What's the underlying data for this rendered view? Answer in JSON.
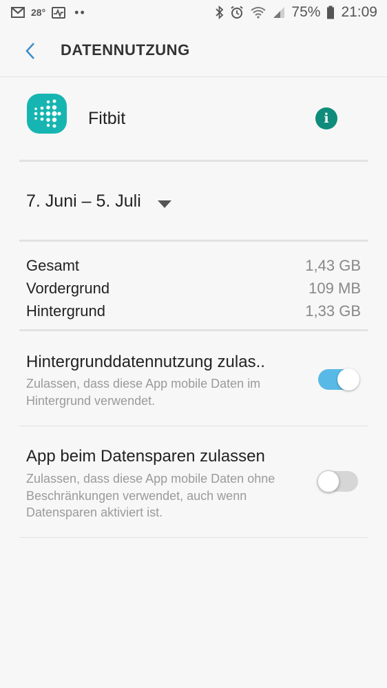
{
  "status_bar": {
    "temperature": "28°",
    "dots": "••",
    "battery": "75%",
    "time": "21:09",
    "icons": [
      "gmail-icon",
      "weather-icon",
      "activity-icon",
      "bluetooth-icon",
      "alarm-icon",
      "wifi-icon",
      "signal-icon",
      "battery-icon"
    ]
  },
  "app_bar": {
    "title": "DATENNUTZUNG",
    "back_icon": "chevron-left-icon"
  },
  "app": {
    "name": "Fitbit",
    "info_label": "i",
    "brand_color": "#17b5b1",
    "info_color": "#0f8c7b"
  },
  "date_range": {
    "label": "7. Juni – 5. Juli"
  },
  "usage": {
    "rows": [
      {
        "label": "Gesamt",
        "value": "1,43 GB"
      },
      {
        "label": "Vordergrund",
        "value": "109 MB"
      },
      {
        "label": "Hintergrund",
        "value": "1,33 GB"
      }
    ]
  },
  "settings": [
    {
      "title": "Hintergrunddatennutzung zulas..",
      "description": "Zulassen, dass diese App mobile Daten im Hintergrund verwendet.",
      "enabled": true
    },
    {
      "title": "App beim Datensparen zulassen",
      "description": "Zulassen, dass diese App mobile Daten ohne Beschränkungen verwendet, auch wenn Datensparen aktiviert ist.",
      "enabled": false
    }
  ],
  "colors": {
    "toggle_on": "#59b9e6",
    "toggle_off": "#d6d6d6",
    "accent": "#3f8fc7"
  }
}
